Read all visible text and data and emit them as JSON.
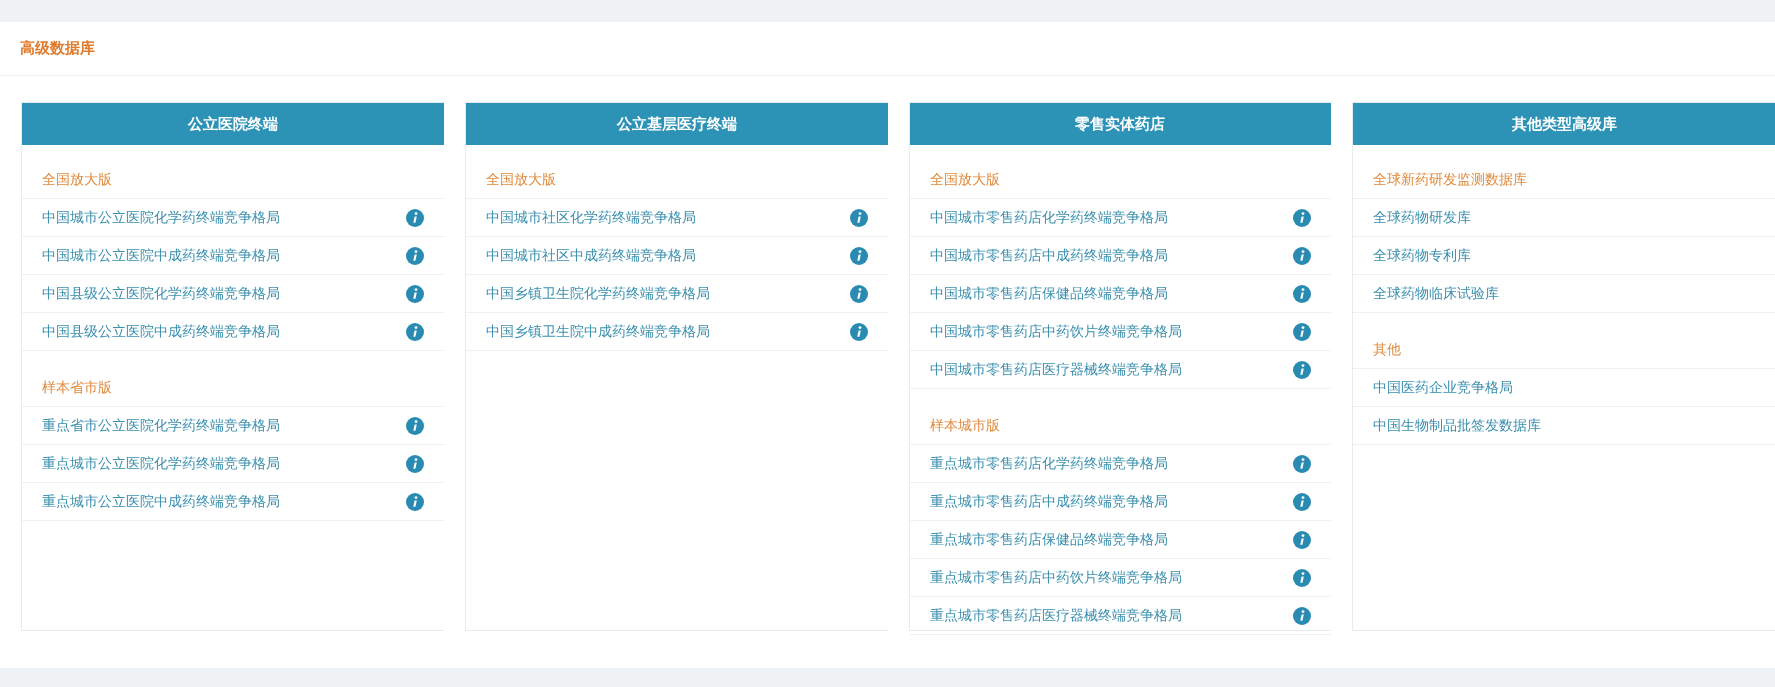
{
  "panel_title": "高级数据库",
  "columns": [
    {
      "title": "公立医院终端",
      "sections": [
        {
          "heading": "全国放大版",
          "items": [
            {
              "label": "中国城市公立医院化学药终端竞争格局",
              "info": true
            },
            {
              "label": "中国城市公立医院中成药终端竞争格局",
              "info": true
            },
            {
              "label": "中国县级公立医院化学药终端竞争格局",
              "info": true
            },
            {
              "label": "中国县级公立医院中成药终端竞争格局",
              "info": true
            }
          ]
        },
        {
          "heading": "样本省市版",
          "items": [
            {
              "label": "重点省市公立医院化学药终端竞争格局",
              "info": true
            },
            {
              "label": "重点城市公立医院化学药终端竞争格局",
              "info": true
            },
            {
              "label": "重点城市公立医院中成药终端竞争格局",
              "info": true
            }
          ]
        }
      ]
    },
    {
      "title": "公立基层医疗终端",
      "sections": [
        {
          "heading": "全国放大版",
          "items": [
            {
              "label": "中国城市社区化学药终端竞争格局",
              "info": true
            },
            {
              "label": "中国城市社区中成药终端竞争格局",
              "info": true
            },
            {
              "label": "中国乡镇卫生院化学药终端竞争格局",
              "info": true
            },
            {
              "label": "中国乡镇卫生院中成药终端竞争格局",
              "info": true
            }
          ]
        }
      ]
    },
    {
      "title": "零售实体药店",
      "sections": [
        {
          "heading": "全国放大版",
          "items": [
            {
              "label": "中国城市零售药店化学药终端竞争格局",
              "info": true
            },
            {
              "label": "中国城市零售药店中成药终端竞争格局",
              "info": true
            },
            {
              "label": "中国城市零售药店保健品终端竞争格局",
              "info": true
            },
            {
              "label": "中国城市零售药店中药饮片终端竞争格局",
              "info": true
            },
            {
              "label": "中国城市零售药店医疗器械终端竞争格局",
              "info": true
            }
          ]
        },
        {
          "heading": "样本城市版",
          "items": [
            {
              "label": "重点城市零售药店化学药终端竞争格局",
              "info": true
            },
            {
              "label": "重点城市零售药店中成药终端竞争格局",
              "info": true
            },
            {
              "label": "重点城市零售药店保健品终端竞争格局",
              "info": true
            },
            {
              "label": "重点城市零售药店中药饮片终端竞争格局",
              "info": true
            },
            {
              "label": "重点城市零售药店医疗器械终端竞争格局",
              "info": true
            }
          ]
        }
      ]
    },
    {
      "title": "其他类型高级库",
      "sections": [
        {
          "heading": "全球新药研发监测数据库",
          "items": [
            {
              "label": "全球药物研发库",
              "info": false
            },
            {
              "label": "全球药物专利库",
              "info": false
            },
            {
              "label": "全球药物临床试验库",
              "info": false
            }
          ]
        },
        {
          "heading": "其他",
          "items": [
            {
              "label": "中国医药企业竞争格局",
              "info": false
            },
            {
              "label": "中国生物制品批签发数据库",
              "info": false
            }
          ]
        }
      ]
    }
  ]
}
